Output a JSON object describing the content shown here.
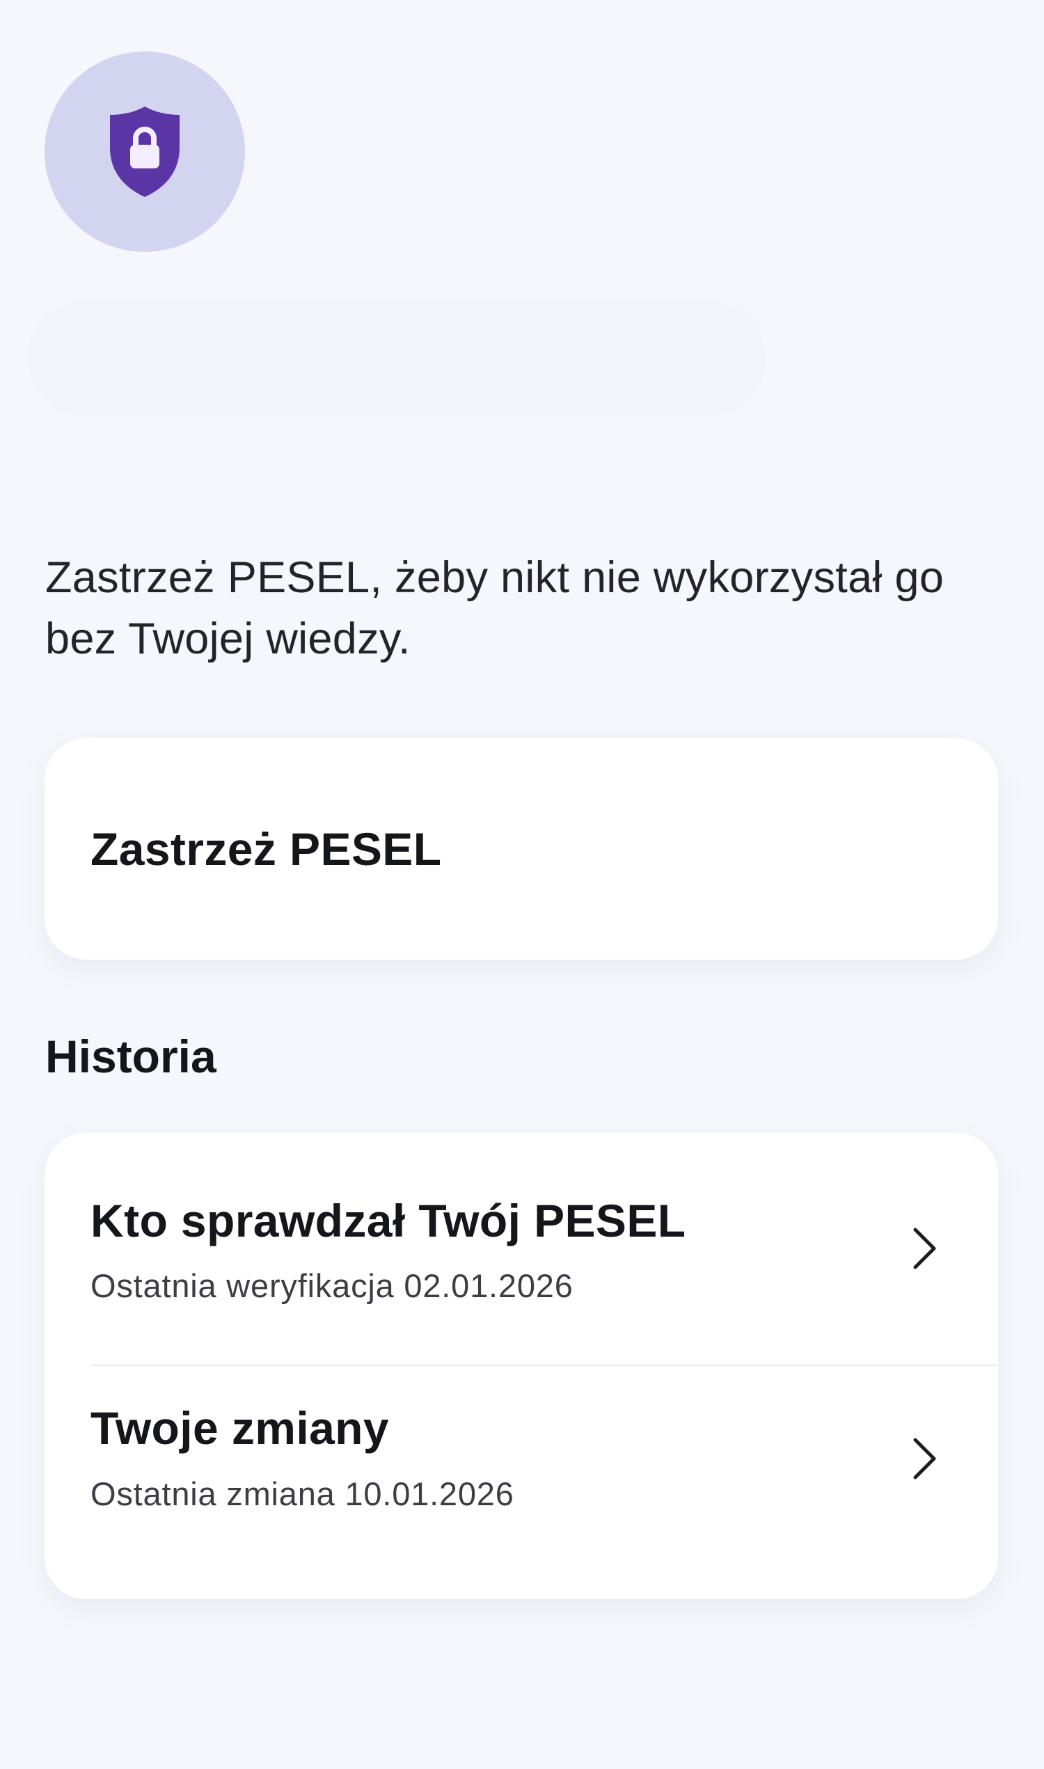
{
  "hero": {
    "icon": "shield-lock-icon",
    "badge_color": "#d3d4ef",
    "shield_color": "#5b35a6"
  },
  "intro": {
    "text": "Zastrzeż PESEL, żeby nikt nie wykorzystał go bez Twojej wiedzy."
  },
  "action": {
    "label": "Zastrzeż PESEL"
  },
  "history": {
    "title": "Historia",
    "items": [
      {
        "title": "Kto sprawdzał Twój PESEL",
        "subtitle": "Ostatnia weryfikacja 02.01.2026",
        "icon": "chevron-right-icon"
      },
      {
        "title": "Twoje zmiany",
        "subtitle": "Ostatnia zmiana 10.01.2026",
        "icon": "chevron-right-icon"
      }
    ]
  },
  "colors": {
    "background": "#f6f7fc",
    "card": "#ffffff",
    "text_primary": "#15151c",
    "text_secondary": "#3d3d46",
    "divider": "#e7e8ee"
  }
}
